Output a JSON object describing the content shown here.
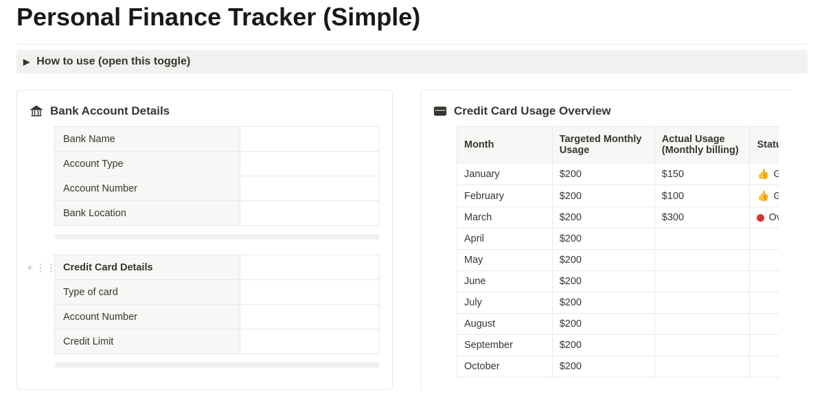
{
  "page_title": "Personal Finance Tracker (Simple)",
  "toggle_label": "How to use (open this toggle)",
  "left_card": {
    "section1_title": "Bank Account Details",
    "section1_rows": [
      {
        "key": "Bank Name",
        "value": ""
      },
      {
        "key": "Account Type",
        "value": ""
      },
      {
        "key": "Account Number",
        "value": ""
      },
      {
        "key": "Bank Location",
        "value": ""
      }
    ],
    "section2_title": "Credit Card Details",
    "section2_rows": [
      {
        "key": "Type of card",
        "value": ""
      },
      {
        "key": "Account Number",
        "value": ""
      },
      {
        "key": "Credit Limit",
        "value": ""
      }
    ]
  },
  "right_card": {
    "title": "Credit Card Usage Overview",
    "columns": [
      "Month",
      "Targeted Monthly Usage",
      "Actual Usage (Monthly billing)",
      "Status"
    ],
    "rows": [
      {
        "month": "January",
        "target": "$200",
        "actual": "$150",
        "status_icon": "👍",
        "status_label": "Good"
      },
      {
        "month": "February",
        "target": "$200",
        "actual": "$100",
        "status_icon": "👍",
        "status_label": "Good"
      },
      {
        "month": "March",
        "target": "$200",
        "actual": "$300",
        "status_icon": "red-dot",
        "status_label": "Overs"
      },
      {
        "month": "April",
        "target": "$200",
        "actual": "",
        "status_icon": "",
        "status_label": ""
      },
      {
        "month": "May",
        "target": "$200",
        "actual": "",
        "status_icon": "",
        "status_label": ""
      },
      {
        "month": "June",
        "target": "$200",
        "actual": "",
        "status_icon": "",
        "status_label": ""
      },
      {
        "month": "July",
        "target": "$200",
        "actual": "",
        "status_icon": "",
        "status_label": ""
      },
      {
        "month": "August",
        "target": "$200",
        "actual": "",
        "status_icon": "",
        "status_label": ""
      },
      {
        "month": "September",
        "target": "$200",
        "actual": "",
        "status_icon": "",
        "status_label": ""
      },
      {
        "month": "October",
        "target": "$200",
        "actual": "",
        "status_icon": "",
        "status_label": ""
      }
    ]
  }
}
